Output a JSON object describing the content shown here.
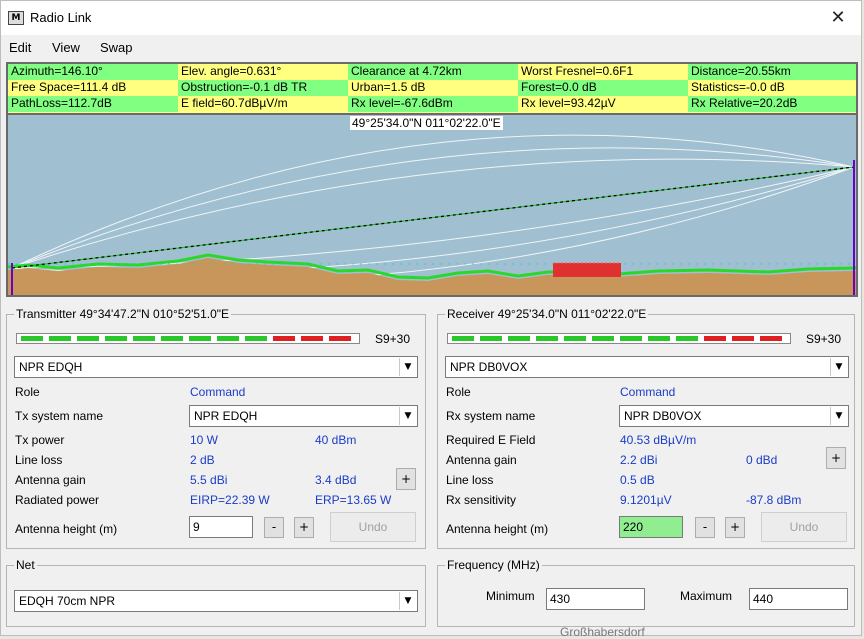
{
  "window": {
    "title": "Radio Link",
    "icon": "radio-mobile-icon",
    "close_glyph": "✕"
  },
  "menu": [
    "Edit",
    "View",
    "Swap"
  ],
  "info": {
    "row1": [
      "Azimuth=146.10°",
      "Elev. angle=0.631°",
      "Clearance at 4.72km",
      "Worst Fresnel=0.6F1",
      "Distance=20.55km"
    ],
    "row2": [
      "Free Space=111.4 dB",
      "Obstruction=-0.1 dB TR",
      "Urban=1.5 dB",
      "Forest=0.0 dB",
      "Statistics=-0.0 dB"
    ],
    "row3": [
      "PathLoss=112.7dB",
      "E field=60.7dBµV/m",
      "Rx level=-67.6dBm",
      "Rx level=93.42µV",
      "Rx Relative=20.2dB"
    ]
  },
  "profile": {
    "coord_label": "49°25'34.0\"N 011°02'22.0\"E",
    "colors": {
      "sky": "#a0bfd0",
      "terrain": "#c8955a",
      "clutter": "#2ad82a",
      "forest": "#e03030",
      "fresnel": "#ffffff"
    }
  },
  "transmitter": {
    "title": "Transmitter 49°34'47.2\"N 010°52'51.0\"E",
    "meter_value": "S9+30",
    "station": "NPR EDQH",
    "role_label": "Role",
    "role_value": "Command",
    "system_label": "Tx system name",
    "system_value": "NPR EDQH",
    "power_label": "Tx power",
    "power_w": "10 W",
    "power_dbm": "40 dBm",
    "line_loss_label": "Line loss",
    "line_loss": "2 dB",
    "gain_label": "Antenna gain",
    "gain_dbi": "5.5 dBi",
    "gain_dbd": "3.4 dBd",
    "plus_label": "+",
    "radiated_label": "Radiated power",
    "eirp": "EIRP=22.39 W",
    "erp": "ERP=13.65 W",
    "height_label": "Antenna height (m)",
    "height_value": "9",
    "minus_btn": "-",
    "plus_btn": "+",
    "undo": "Undo"
  },
  "receiver": {
    "title": "Receiver 49°25'34.0\"N 011°02'22.0\"E",
    "meter_value": "S9+30",
    "station": "NPR DB0VOX",
    "role_label": "Role",
    "role_value": "Command",
    "system_label": "Rx system name",
    "system_value": "NPR DB0VOX",
    "field_label": "Required E Field",
    "field_value": "40.53 dBµV/m",
    "gain_label": "Antenna gain",
    "gain_dbi": "2.2 dBi",
    "gain_dbd": "0 dBd",
    "plus_label": "+",
    "line_loss_label": "Line loss",
    "line_loss": "0.5 dB",
    "sens_label": "Rx sensitivity",
    "sens_uv": "9.1201µV",
    "sens_dbm": "-87.8 dBm",
    "height_label": "Antenna height (m)",
    "height_value": "220",
    "minus_btn": "-",
    "plus_btn": "+",
    "undo": "Undo"
  },
  "net": {
    "title": "Net",
    "value": "EDQH 70cm NPR"
  },
  "frequency": {
    "title": "Frequency (MHz)",
    "min_label": "Minimum",
    "min_value": "430",
    "max_label": "Maximum",
    "max_value": "440"
  },
  "background_text": "Großhabersdorf"
}
